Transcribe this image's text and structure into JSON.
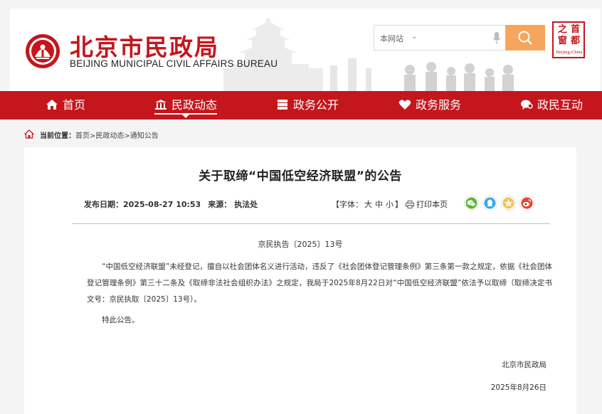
{
  "brand": {
    "name_cn": "北京市民政局",
    "name_en": "BEIJING MUNICIPAL CIVIL AFFAIRS BUREAU",
    "primary_color": "#c4161c",
    "accent_color": "#f4a65c"
  },
  "search": {
    "scope": "本网站",
    "placeholder": "",
    "icon": "search-icon"
  },
  "capital_logo": {
    "chars": [
      "首",
      "都",
      "之",
      "窗"
    ],
    "subtitle": "Beijing-China"
  },
  "nav": {
    "items": [
      {
        "label": "首页",
        "icon": "home-icon",
        "active": false
      },
      {
        "label": "民政动态",
        "icon": "bank-icon",
        "active": true
      },
      {
        "label": "政务公开",
        "icon": "list-icon",
        "active": false
      },
      {
        "label": "政务服务",
        "icon": "heart-icon",
        "active": false
      },
      {
        "label": "政民互动",
        "icon": "chat-icon",
        "active": false
      }
    ]
  },
  "breadcrumb": {
    "label": "当前位置：",
    "path": "首页>民政动态>通知公告"
  },
  "article": {
    "title": "关于取缔“中国低空经济联盟”的公告",
    "publish_label": "发布日期：",
    "publish_date": "2025-08-27 10:53",
    "source_label": "来源：",
    "source": "执法处",
    "fontsize_label": "【字体：",
    "fontsize_options": [
      "大",
      "中",
      "小"
    ],
    "fontsize_close": "】",
    "print_label": "打印本页",
    "share_icons": [
      "wechat-icon",
      "qq-icon",
      "qzone-icon",
      "weibo-icon"
    ],
    "doc_number": "京民执告〔2025〕13号",
    "body_paragraph": "“中国低空经济联盟”未经登记，擅自以社会团体名义进行活动，违反了《社会团体登记管理条例》第三条第一款之规定，依据《社会团体登记管理条例》第三十二条及《取缔非法社会组织办法》之规定，我局于2025年8月22日对“中国低空经济联盟”依法予以取缔（取缔决定书文号：京民执取〔2025〕13号）。",
    "closing": "特此公告。",
    "signature": "北京市民政局",
    "sign_date": "2025年8月26日"
  }
}
